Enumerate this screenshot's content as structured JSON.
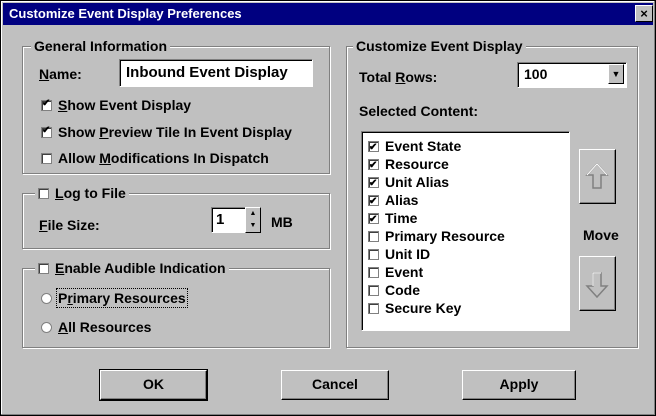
{
  "window": {
    "title": "Customize Event Display Preferences",
    "close_glyph": "×"
  },
  "general": {
    "legend": "General Information",
    "name_label_u": "N",
    "name_label_rest": "ame:",
    "name_value": "Inbound Event Display",
    "show_event_u": "S",
    "show_event_rest": "how Event Display",
    "show_event_checked": true,
    "show_preview_pre": "Show ",
    "show_preview_u": "P",
    "show_preview_rest": "review Tile In Event Display",
    "show_preview_checked": true,
    "allow_mod_pre": "Allow ",
    "allow_mod_u": "M",
    "allow_mod_rest": "odifications In Dispatch",
    "allow_mod_checked": false
  },
  "log": {
    "legend_u": "L",
    "legend_rest": "og to File",
    "checked": false,
    "filesize_u": "F",
    "filesize_rest": "ile Size:",
    "filesize_value": "1",
    "unit": "MB"
  },
  "audible": {
    "legend_u": "E",
    "legend_rest": "nable Audible Indication",
    "checked": false,
    "opt1_pre": "P",
    "opt1_u": "r",
    "opt1_rest": "imary Resources",
    "opt2_u": "A",
    "opt2_rest": "ll Resources"
  },
  "customize": {
    "legend": "Customize Event Display",
    "total_rows_pre": "Total ",
    "total_rows_u": "R",
    "total_rows_rest": "ows:",
    "total_rows_value": "100",
    "selected_content": "Selected Content:",
    "items": [
      {
        "label": "Event State",
        "checked": true
      },
      {
        "label": "Resource",
        "checked": true
      },
      {
        "label": "Unit Alias",
        "checked": true
      },
      {
        "label": "Alias",
        "checked": true
      },
      {
        "label": "Time",
        "checked": true
      },
      {
        "label": "Primary Resource",
        "checked": false
      },
      {
        "label": "Unit ID",
        "checked": false
      },
      {
        "label": "Event",
        "checked": false
      },
      {
        "label": "Code",
        "checked": false
      },
      {
        "label": "Secure Key",
        "checked": false
      }
    ],
    "move_label": "Move"
  },
  "buttons": {
    "ok": "OK",
    "cancel": "Cancel",
    "apply": "Apply"
  }
}
